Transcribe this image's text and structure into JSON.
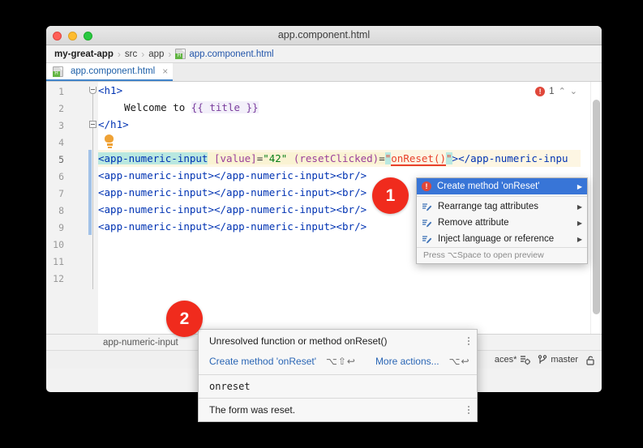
{
  "window": {
    "title": "app.component.html",
    "traffic_lights": [
      "close-red",
      "minimize-yellow",
      "zoom-green"
    ]
  },
  "breadcrumb": {
    "items": [
      {
        "label": "my-great-app",
        "style": "bold"
      },
      {
        "label": "src",
        "style": "normal"
      },
      {
        "label": "app",
        "style": "normal"
      },
      {
        "label": "app.component.html",
        "style": "link",
        "icon": "html-file-icon"
      }
    ],
    "separator": "›"
  },
  "tabs": [
    {
      "label": "app.component.html",
      "icon": "html-file-icon",
      "close": "×",
      "active": true
    }
  ],
  "editor": {
    "line_numbers": [
      "1",
      "2",
      "3",
      "4",
      "5",
      "6",
      "7",
      "8",
      "9",
      "10",
      "11",
      "12"
    ],
    "active_line": 5,
    "error_badge": {
      "count": "1",
      "up": "⌃",
      "down": "⌄"
    },
    "lines": {
      "l1_tag_open": "<h1>",
      "l2_text": "Welcome to ",
      "l2_expr": "{{ title }}",
      "l3_tag_close": "</h1>",
      "l5_tag": "<app-numeric-input",
      "l5_attr1": " [value]",
      "l5_eq1": "=",
      "l5_val1": "\"42\"",
      "l5_attr2": " (resetClicked)",
      "l5_eq2": "=",
      "l5_quote_open": "\"",
      "l5_handler": "onReset()",
      "l5_quote_close": "\"",
      "l5_gt": ">",
      "l5_closetag": "</app-numeric-inpu",
      "repeat_line": "<app-numeric-input></app-numeric-input><br/>"
    }
  },
  "bottom_breadcrumb": {
    "label": "app-numeric-input"
  },
  "statusbar": {
    "indent": "aces*",
    "indent_icon": "indent-settings-icon",
    "branch_icon": "git-branch-icon",
    "branch": "master",
    "lock_icon": "lock-icon"
  },
  "context_menu": {
    "items": [
      {
        "label": "Create method 'onReset'",
        "icon": "error-bulb-icon",
        "arrow": "▶",
        "selected": true
      },
      {
        "label": "Rearrange tag attributes",
        "icon": "edit-pencil-icon",
        "arrow": "▶",
        "selected": false
      },
      {
        "label": "Remove attribute",
        "icon": "edit-pencil-icon",
        "arrow": "▶",
        "selected": false
      },
      {
        "label": "Inject language or reference",
        "icon": "edit-pencil-icon",
        "arrow": "▶",
        "selected": false
      }
    ],
    "hint": "Press ⌥Space to open preview"
  },
  "tooltip": {
    "title": "Unresolved function or method onReset()",
    "action_primary": {
      "label": "Create method 'onReset'",
      "shortcut": "⌥⇧↩"
    },
    "action_secondary": {
      "label": "More actions...",
      "shortcut": "⌥↩"
    },
    "code": "onreset",
    "description": "The form was reset.",
    "kebab": "more-options-icon"
  },
  "annotations": [
    {
      "id": "1",
      "label": "1"
    },
    {
      "id": "2",
      "label": "2"
    }
  ],
  "colors": {
    "accent_blue": "#3875d7",
    "error_red": "#f02b1d",
    "link_blue": "#2a66b5",
    "tag_blue": "#0033b3",
    "string_green": "#067d17",
    "highlight_cyan": "#b9e8e0"
  }
}
